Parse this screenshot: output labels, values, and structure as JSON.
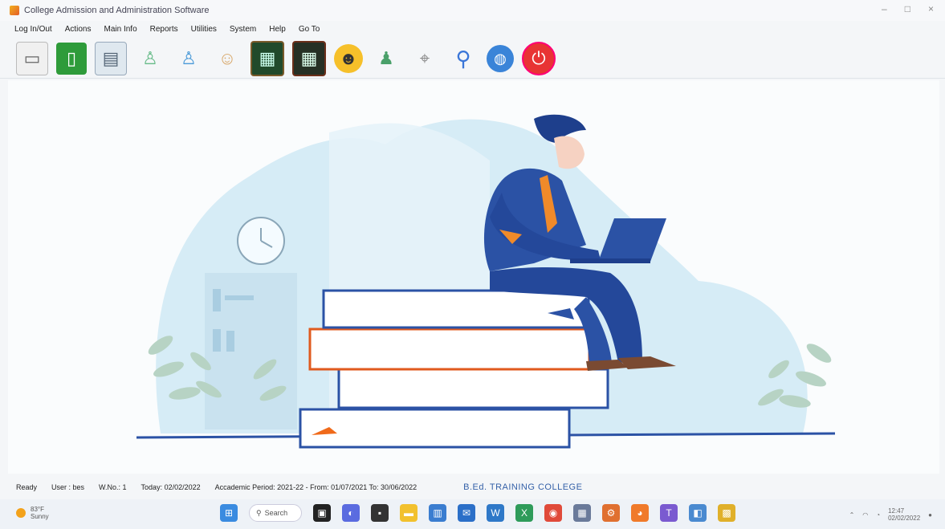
{
  "window": {
    "title": "College Admission and Administration Software",
    "controls": [
      "–",
      "□",
      "×"
    ]
  },
  "menu": [
    "Log In/Out",
    "Actions",
    "Main Info",
    "Reports",
    "Utilities",
    "System",
    "Help",
    "Go To"
  ],
  "toolbar": {
    "buttons": [
      {
        "icon": "document-icon",
        "glyph": "▭"
      },
      {
        "icon": "clipboard-icon",
        "glyph": "▯"
      },
      {
        "icon": "book-icon",
        "glyph": "▤"
      },
      {
        "icon": "student-icon",
        "glyph": "♙"
      },
      {
        "icon": "teacher-icon",
        "glyph": "♙"
      },
      {
        "icon": "staff-icon",
        "glyph": "☺"
      },
      {
        "icon": "board-icon",
        "glyph": "▦"
      },
      {
        "icon": "blackboard-icon",
        "glyph": "▦"
      },
      {
        "icon": "avatar-icon",
        "glyph": "☻"
      },
      {
        "icon": "user-icon",
        "glyph": "♟"
      },
      {
        "icon": "calculator-icon",
        "glyph": "⌖"
      },
      {
        "icon": "search-icon",
        "glyph": "⚲"
      },
      {
        "icon": "globe-icon",
        "glyph": "◍"
      },
      {
        "icon": "power-icon",
        "glyph": "⏻"
      }
    ]
  },
  "status": {
    "state": "Ready",
    "user": "User : bes",
    "wno": "W.No.: 1",
    "today": "Today: 02/02/2022",
    "period": "Accademic Period: 2021-22 - From: 01/07/2021 To: 30/06/2022",
    "college": "B.Ed. TRAINING COLLEGE"
  },
  "taskbar": {
    "weather_temp": "83°F",
    "weather_desc": "Sunny",
    "search_label": "Search",
    "time": "12:47",
    "date": "02/02/2022"
  },
  "colors": {
    "accent": "#3561a8",
    "blob": "#cfe6f3",
    "suit": "#2b52a5",
    "tie": "#f08a2a"
  }
}
